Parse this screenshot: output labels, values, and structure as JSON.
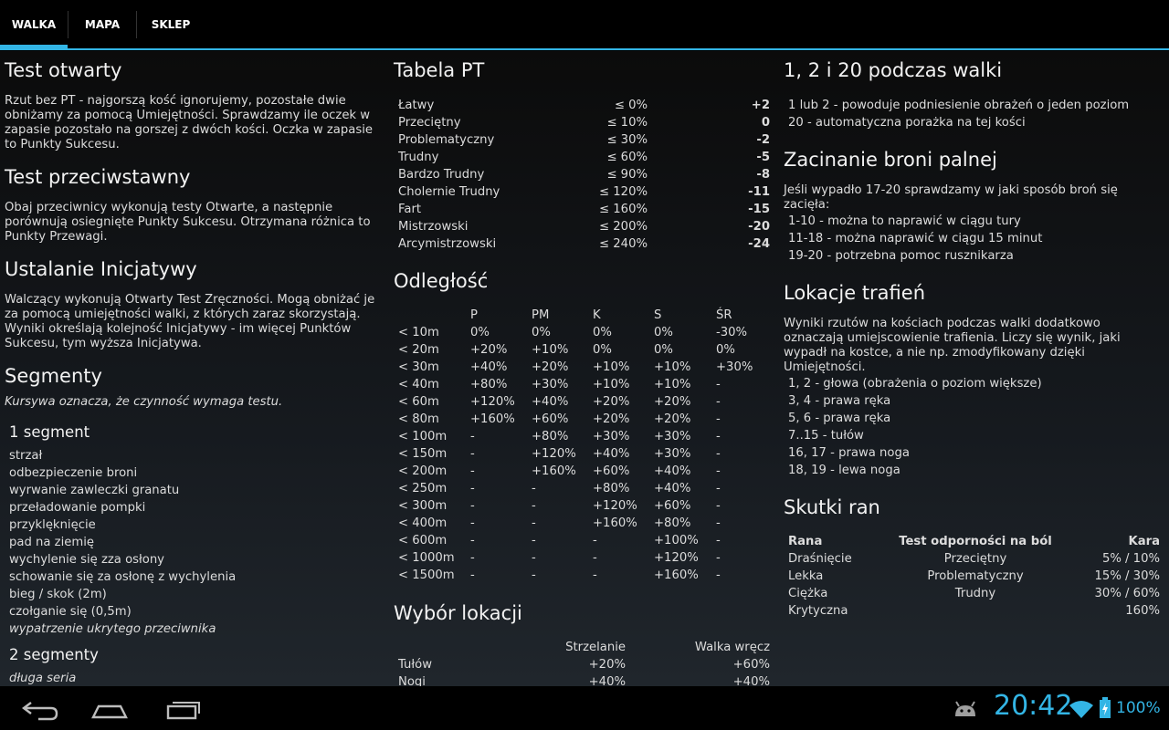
{
  "tabs": [
    {
      "label": "WALKA",
      "active": true
    },
    {
      "label": "MAPA",
      "active": false
    },
    {
      "label": "SKLEP",
      "active": false
    }
  ],
  "col1": {
    "test_otwarty": {
      "title": "Test otwarty",
      "text": "Rzut bez PT - najgorszą kość ignorujemy, pozostałe dwie obniżamy za pomocą Umiejętności. Sprawdzamy ile oczek w zapasie pozostało na gorszej z dwóch kości. Oczka w zapasie to Punkty Sukcesu."
    },
    "test_przeciwstawny": {
      "title": "Test przeciwstawny",
      "text": "Obaj przeciwnicy wykonują testy Otwarte, a następnie porównują osiegnięte Punkty Sukcesu. Otrzymana różnica to Punkty Przewagi."
    },
    "inicjatywa": {
      "title": "Ustalanie Inicjatywy",
      "text": "Walczący wykonują Otwarty Test Zręczności. Mogą obniżać je za pomocą umiejętności walki, z których zaraz skorzystają. Wyniki określają kolejność Inicjatywy - im więcej Punktów Sukcesu, tym wyższa Inicjatywa."
    },
    "segmenty": {
      "title": "Segmenty",
      "note": "Kursywa oznacza, że czynność wymaga testu.",
      "seg1_title": "1 segment",
      "seg1_items": [
        "strzał",
        "odbezpieczenie broni",
        "wyrwanie zawleczki granatu",
        "przeładowanie pompki",
        "przyklęknięcie",
        "pad na ziemię",
        "wychylenie się zza osłony",
        "schowanie się za osłonę z wychylenia",
        "bieg / skok (2m)",
        "czołganie się (0,5m)",
        "wypatrzenie ukrytego przeciwnika"
      ],
      "seg2_title": "2 segmenty",
      "seg2_items": [
        "długa seria"
      ]
    }
  },
  "col2": {
    "tabela_pt": {
      "title": "Tabela PT",
      "rows": [
        [
          "Łatwy",
          "≤ 0%",
          "+2"
        ],
        [
          "Przeciętny",
          "≤ 10%",
          "0"
        ],
        [
          "Problematyczny",
          "≤ 30%",
          "-2"
        ],
        [
          "Trudny",
          "≤ 60%",
          "-5"
        ],
        [
          "Bardzo Trudny",
          "≤ 90%",
          "-8"
        ],
        [
          "Cholernie Trudny",
          "≤ 120%",
          "-11"
        ],
        [
          "Fart",
          "≤ 160%",
          "-15"
        ],
        [
          "Mistrzowski",
          "≤ 200%",
          "-20"
        ],
        [
          "Arcymistrzowski",
          "≤ 240%",
          "-24"
        ]
      ]
    },
    "odleglosc": {
      "title": "Odległość",
      "headers": [
        "",
        "P",
        "PM",
        "K",
        "S",
        "ŚR"
      ],
      "rows": [
        [
          "< 10m",
          "0%",
          "0%",
          "0%",
          "0%",
          "-30%"
        ],
        [
          "< 20m",
          "+20%",
          "+10%",
          "0%",
          "0%",
          "0%"
        ],
        [
          "< 30m",
          "+40%",
          "+20%",
          "+10%",
          "+10%",
          "+30%"
        ],
        [
          "< 40m",
          "+80%",
          "+30%",
          "+10%",
          "+10%",
          "-"
        ],
        [
          "< 60m",
          "+120%",
          "+40%",
          "+20%",
          "+20%",
          "-"
        ],
        [
          "< 80m",
          "+160%",
          "+60%",
          "+20%",
          "+20%",
          "-"
        ],
        [
          "< 100m",
          "-",
          "+80%",
          "+30%",
          "+30%",
          "-"
        ],
        [
          "< 150m",
          "-",
          "+120%",
          "+40%",
          "+30%",
          "-"
        ],
        [
          "< 200m",
          "-",
          "+160%",
          "+60%",
          "+40%",
          "-"
        ],
        [
          "< 250m",
          "-",
          "-",
          "+80%",
          "+40%",
          "-"
        ],
        [
          "< 300m",
          "-",
          "-",
          "+120%",
          "+60%",
          "-"
        ],
        [
          "< 400m",
          "-",
          "-",
          "+160%",
          "+80%",
          "-"
        ],
        [
          "< 600m",
          "-",
          "-",
          "-",
          "+100%",
          "-"
        ],
        [
          "< 1000m",
          "-",
          "-",
          "-",
          "+120%",
          "-"
        ],
        [
          "< 1500m",
          "-",
          "-",
          "-",
          "+160%",
          "-"
        ]
      ]
    },
    "wybor_lokacji": {
      "title": "Wybór lokacji",
      "headers": [
        "",
        "Strzelanie",
        "Walka wręcz"
      ],
      "rows": [
        [
          "Tułów",
          "+20%",
          "+60%"
        ],
        [
          "Nogi",
          "+40%",
          "+40%"
        ]
      ]
    }
  },
  "col3": {
    "rzuty": {
      "title": "1, 2 i 20 podczas walki",
      "items": [
        "1 lub 2 - powoduje podniesienie obrażeń o jeden poziom",
        "20 - automatyczna porażka na tej kości"
      ]
    },
    "zacinanie": {
      "title": "Zacinanie broni palnej",
      "text": "Jeśli wypadło 17-20 sprawdzamy w jaki sposób broń się zacięła:",
      "items": [
        "1-10 - można to naprawić w ciągu tury",
        "11-18 - można naprawić w ciągu 15 minut",
        "19-20 - potrzebna pomoc rusznikarza"
      ]
    },
    "lokacje": {
      "title": "Lokacje trafień",
      "text": "Wyniki rzutów na kościach podczas walki dodatkowo oznaczają umiejscowienie trafienia. Liczy się wynik, jaki wypadł na kostce, a nie np. zmodyfikowany dzięki Umiejętności.",
      "items": [
        "1, 2 - głowa (obrażenia o poziom większe)",
        "3, 4 - prawa ręka",
        "5, 6 - prawa ręka",
        "7..15 - tułów",
        "16, 17 - prawa noga",
        "18, 19 - lewa noga"
      ]
    },
    "skutki": {
      "title": "Skutki ran",
      "headers": [
        "Rana",
        "Test odporności na ból",
        "Kara"
      ],
      "rows": [
        [
          "Draśnięcie",
          "Przeciętny",
          "5% / 10%"
        ],
        [
          "Lekka",
          "Problematyczny",
          "15% / 30%"
        ],
        [
          "Ciężka",
          "Trudny",
          "30% / 60%"
        ],
        [
          "Krytyczna",
          "",
          "160%"
        ]
      ]
    }
  },
  "statusbar": {
    "time": "20:42",
    "battery": "100%"
  },
  "colors": {
    "accent": "#33b5e5",
    "background": "#000000"
  }
}
